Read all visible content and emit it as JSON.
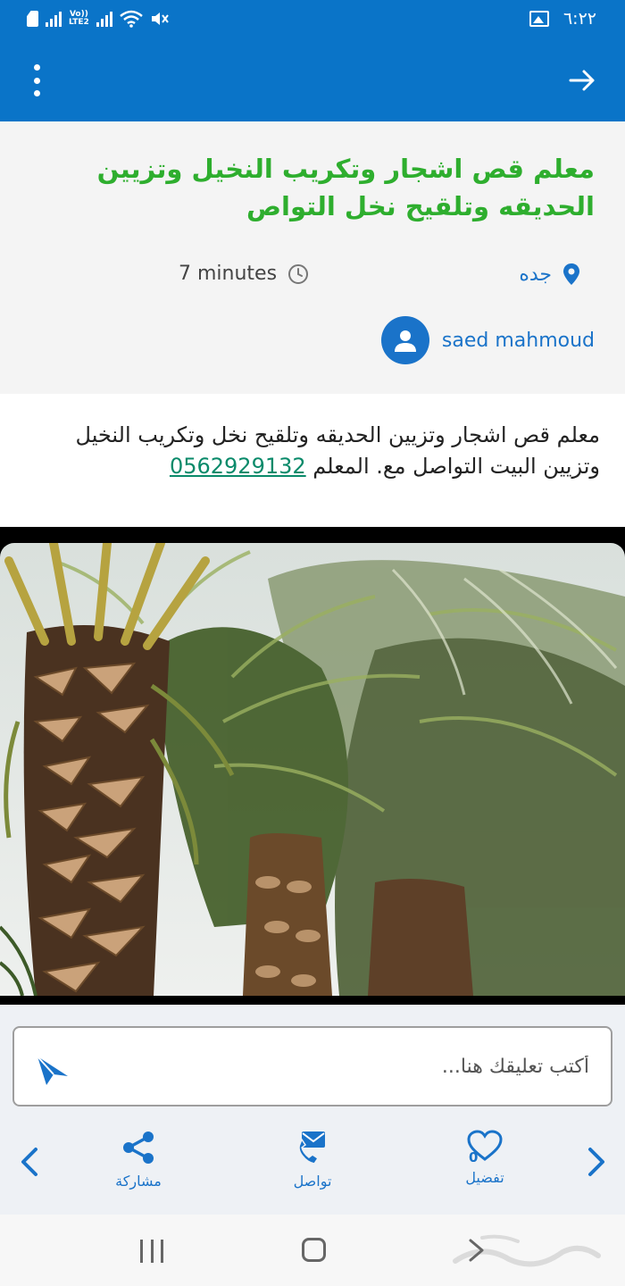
{
  "status_bar": {
    "time": "٦:٢٢",
    "network_label": "LTE2",
    "volte_label": "Vo))"
  },
  "header": {
    "title": "معلم قص اشجار وتكريب النخيل وتزيين الحديقه وتلقيح نخل التواص",
    "location": "جده",
    "time_ago": "7 minutes",
    "author": "saed mahmoud"
  },
  "description": {
    "text": "معلم قص اشجار وتزيين الحديقه وتلقيح نخل وتكريب النخيل وتزيين البيت التواصل مع. المعلم",
    "phone": "0562929132"
  },
  "comment": {
    "placeholder": "أكتب تعليقك هنا..."
  },
  "actions": {
    "favorite_label": "تفضيل",
    "favorite_count": "0",
    "contact_label": "تواصل",
    "share_label": "مشاركة"
  },
  "colors": {
    "app_bar": "#0a74c8",
    "title_green": "#2eae2e",
    "accent_blue": "#1a73c9",
    "phone_link": "#0a8a6a"
  }
}
